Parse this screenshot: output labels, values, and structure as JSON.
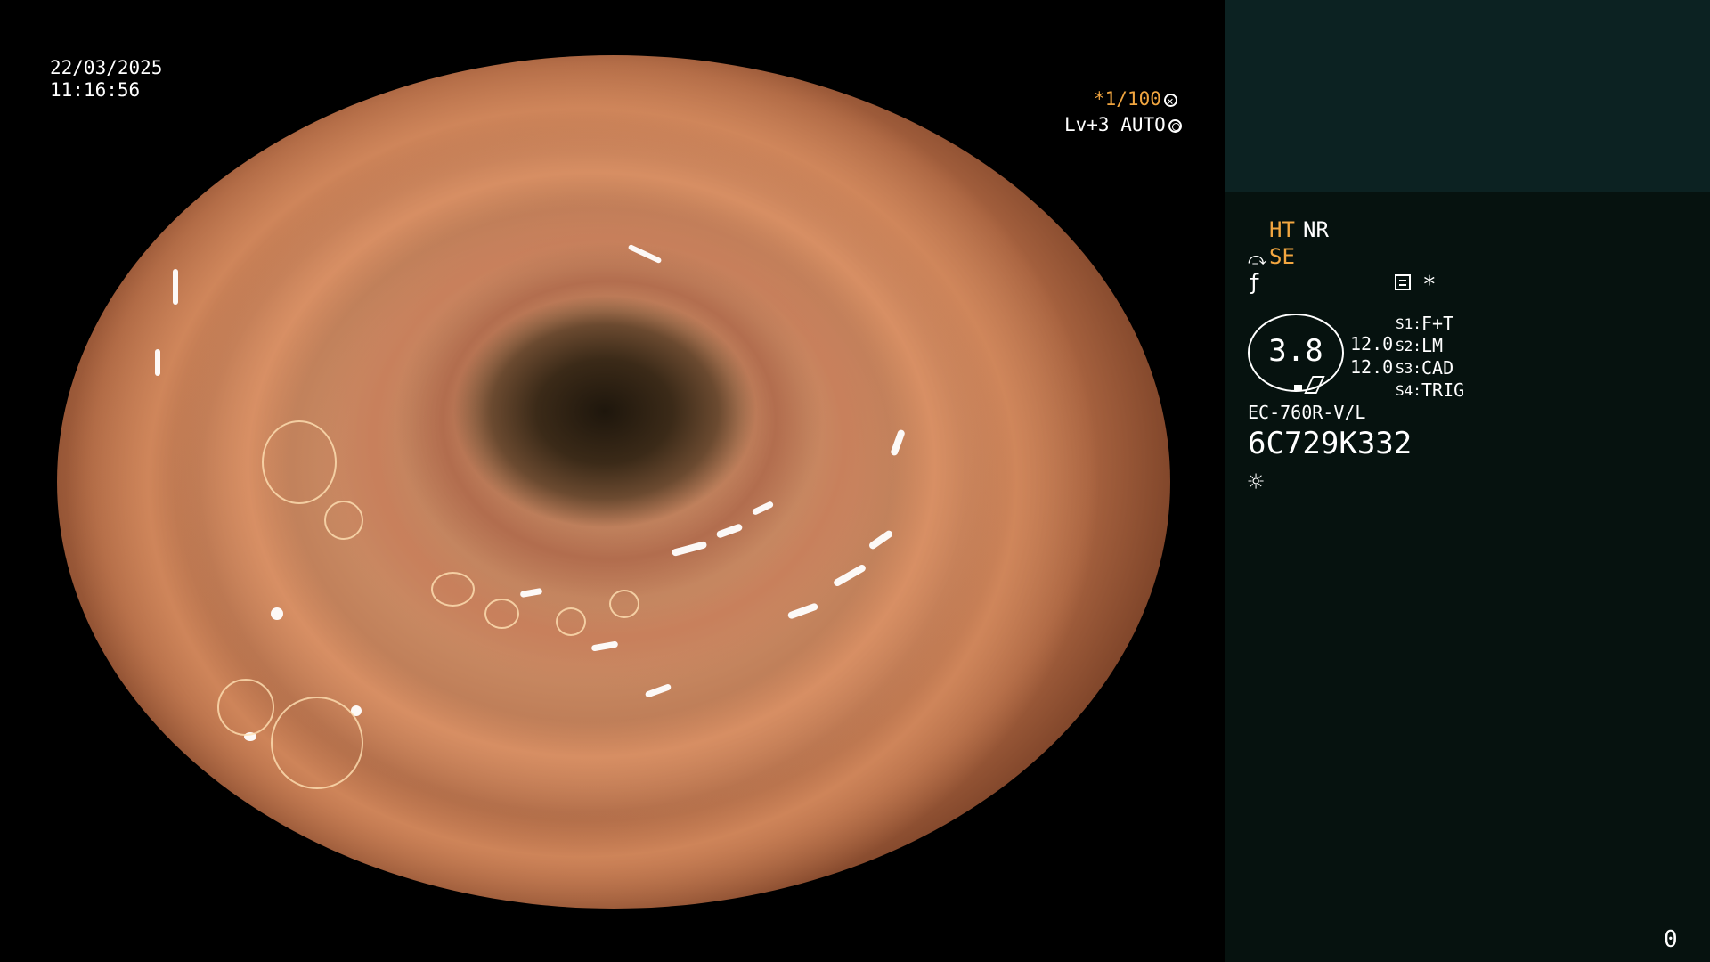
{
  "overlay": {
    "date": "22/03/2025",
    "time": "11:16:56",
    "shutter": "*1/100",
    "level": "Lv+3 AUTO"
  },
  "panel": {
    "ht": "HT",
    "nr": "NR",
    "se": "SE",
    "star": "*",
    "gauge_value": "3.8",
    "gauge_left_top": "12.0",
    "gauge_left_bottom": "12.0",
    "settings": [
      {
        "key": "S1:",
        "value": "F+T"
      },
      {
        "key": "S2:",
        "value": "LM"
      },
      {
        "key": "S3:",
        "value": "CAD"
      },
      {
        "key": "S4:",
        "value": "TRIG"
      }
    ],
    "model": "EC-760R-V/L",
    "serial": "6C729K332",
    "counter": "0"
  },
  "icons": {
    "shutter": "aperture-icon",
    "auto": "auto-iris-icon",
    "se": "scope-tip-icon",
    "f": "function-icon",
    "doc": "document-icon",
    "sun": "light-icon"
  },
  "colors": {
    "highlight": "#f2a640",
    "panel_bg": "#06120f",
    "panel_header": "#0c2222"
  }
}
